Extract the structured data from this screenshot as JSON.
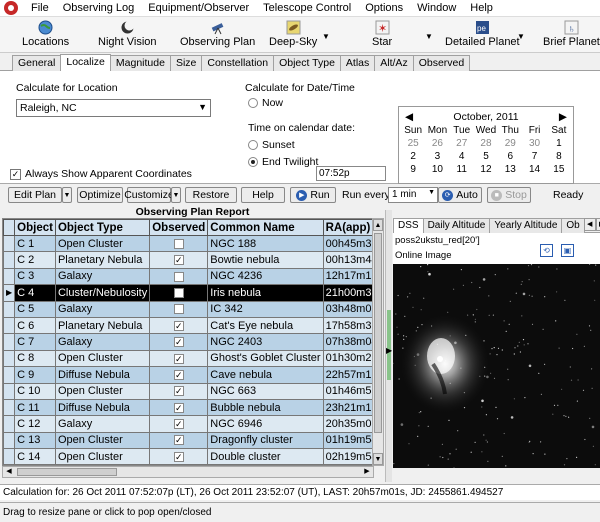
{
  "menu": [
    "File",
    "Observing Log",
    "Equipment/Observer",
    "Telescope Control",
    "Options",
    "Window",
    "Help"
  ],
  "toolbar": {
    "buttons": [
      "Locations",
      "Night Vision",
      "Observing Plan",
      "Deep-Sky",
      "Star",
      "Detailed Planet",
      "Brief Planet"
    ],
    "icons": [
      "globe-icon",
      "moon-icon",
      "telescope-icon",
      "galaxy-icon",
      "star-icon",
      "planet-icon",
      "planet-icon"
    ]
  },
  "tabs": [
    "General",
    "Localize",
    "Magnitude",
    "Size",
    "Constellation",
    "Object Type",
    "Atlas",
    "Alt/Az",
    "Observed"
  ],
  "localize": {
    "calc_location_label": "Calculate for Location",
    "location_value": "Raleigh, NC",
    "always_apparent_label": "Always Show Apparent Coordinates",
    "calc_date_label": "Calculate for Date/Time",
    "now_label": "Now",
    "time_on_date_label": "Time on calendar date:",
    "sunset_label": "Sunset",
    "end_twilight_label": "End Twilight",
    "time_value": "07:52p",
    "calendar": {
      "month": "October, 2011",
      "days": [
        "Sun",
        "Mon",
        "Tue",
        "Wed",
        "Thu",
        "Fri",
        "Sat"
      ],
      "weeks": [
        [
          "25",
          "26",
          "27",
          "28",
          "29",
          "30",
          "1"
        ],
        [
          "2",
          "3",
          "4",
          "5",
          "6",
          "7",
          "8"
        ],
        [
          "9",
          "10",
          "11",
          "12",
          "13",
          "14",
          "15"
        ]
      ]
    }
  },
  "actions": {
    "edit_plan": "Edit Plan",
    "optimize": "Optimize",
    "customize": "Customize",
    "restore": "Restore",
    "help": "Help",
    "run": "Run",
    "run_every_label": "Run every:",
    "run_every_value": "1 min",
    "auto": "Auto",
    "stop": "Stop",
    "status": "Ready"
  },
  "report": {
    "title": "Observing Plan Report",
    "columns": [
      "Object",
      "Object Type",
      "Observed",
      "Common Name",
      "RA(app)"
    ],
    "rows": [
      {
        "object": "C 1",
        "type": "Open Cluster",
        "observed": false,
        "name": "NGC 188",
        "ra": "00h45m32s.0"
      },
      {
        "object": "C 2",
        "type": "Planetary Nebula",
        "observed": true,
        "name": "Bowtie nebula",
        "ra": "00h13m44s.0"
      },
      {
        "object": "C 3",
        "type": "Galaxy",
        "observed": false,
        "name": "NGC 4236",
        "ra": "12h17m12s.6"
      },
      {
        "object": "C 4",
        "type": "Cluster/Nebulosity",
        "observed": false,
        "name": "Iris nebula",
        "ra": "21h00m39s.4"
      },
      {
        "object": "C 5",
        "type": "Galaxy",
        "observed": false,
        "name": "IC 342",
        "ra": "03h48m02s.4"
      },
      {
        "object": "C 6",
        "type": "Planetary Nebula",
        "observed": true,
        "name": "Cat's Eye nebula",
        "ra": "17h58m33s.8"
      },
      {
        "object": "C 7",
        "type": "Galaxy",
        "observed": true,
        "name": "NGC 2403",
        "ra": "07h38m04s.1"
      },
      {
        "object": "C 8",
        "type": "Open Cluster",
        "observed": true,
        "name": "Ghost's Goblet Cluster",
        "ra": "01h30m22s.6"
      },
      {
        "object": "C 9",
        "type": "Diffuse Nebula",
        "observed": true,
        "name": "Cave nebula",
        "ra": "22h57m12s.7"
      },
      {
        "object": "C 10",
        "type": "Open Cluster",
        "observed": true,
        "name": "NGC 663",
        "ra": "01h46m53s.7"
      },
      {
        "object": "C 11",
        "type": "Diffuse Nebula",
        "observed": true,
        "name": "Bubble nebula",
        "ra": "23h21m16s.3"
      },
      {
        "object": "C 12",
        "type": "Galaxy",
        "observed": true,
        "name": "NGC 6946",
        "ra": "20h35m02s.2"
      },
      {
        "object": "C 13",
        "type": "Open Cluster",
        "observed": true,
        "name": "Dragonfly cluster",
        "ra": "01h19m54s.7"
      },
      {
        "object": "C 14",
        "type": "Open Cluster",
        "observed": true,
        "name": "Double cluster",
        "ra": "02h19m54s.1"
      }
    ],
    "selected_index": 3
  },
  "image_panel": {
    "tabs": [
      "DSS",
      "Daily Altitude",
      "Yearly Altitude",
      "Ob"
    ],
    "survey": "poss2ukstu_red[20']",
    "label": "Online Image"
  },
  "status": {
    "calc_line": "Calculation for: 26 Oct 2011 07:52:07p (LT), 26 Oct 2011 23:52:07 (UT), LAST: 20h57m01s, JD: 2455861.494527",
    "hint": "Drag to resize pane or click to pop open/closed"
  }
}
